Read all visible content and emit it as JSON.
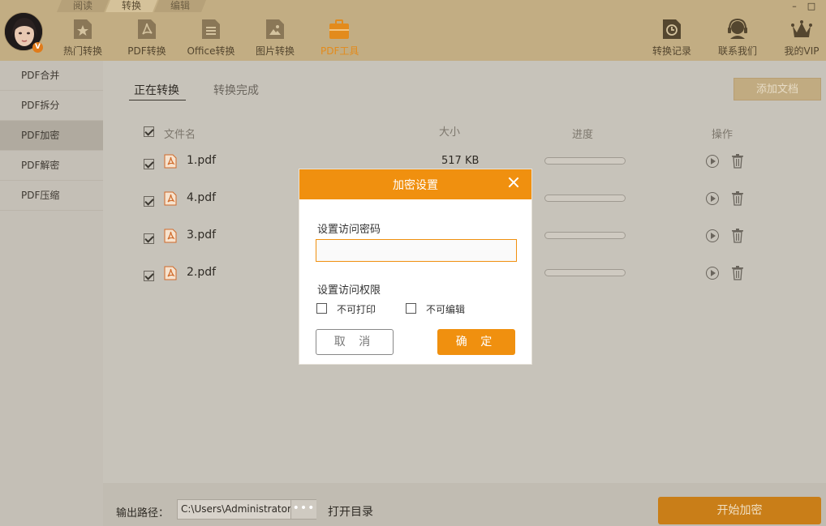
{
  "mode_tabs": [
    "阅读",
    "转换",
    "编辑"
  ],
  "window_controls": {
    "minimize": "–",
    "maximize": "□"
  },
  "toolbar": {
    "left": [
      {
        "label": "热门转换",
        "icon": "star-doc-icon"
      },
      {
        "label": "PDF转换",
        "icon": "pdf-doc-icon"
      },
      {
        "label": "Office转换",
        "icon": "office-doc-icon"
      },
      {
        "label": "图片转换",
        "icon": "image-doc-icon"
      },
      {
        "label": "PDF工具",
        "icon": "briefcase-icon"
      }
    ],
    "right": [
      {
        "label": "转换记录",
        "icon": "history-clock-icon"
      },
      {
        "label": "联系我们",
        "icon": "headset-icon"
      },
      {
        "label": "我的VIP",
        "icon": "crown-icon"
      }
    ]
  },
  "avatar_badge": "V",
  "sidebar": {
    "items": [
      "PDF合并",
      "PDF拆分",
      "PDF加密",
      "PDF解密",
      "PDF压缩"
    ],
    "active": "PDF加密"
  },
  "main": {
    "tabs": [
      "正在转换",
      "转换完成"
    ],
    "add_button": "添加文档",
    "columns": {
      "filename": "文件名",
      "size": "大小",
      "progress": "进度",
      "actions": "操作"
    },
    "files": [
      {
        "name": "1.pdf",
        "size": "517 KB",
        "progress": 0
      },
      {
        "name": "4.pdf",
        "size": "",
        "progress": 0
      },
      {
        "name": "3.pdf",
        "size": "",
        "progress": 0
      },
      {
        "name": "2.pdf",
        "size": "",
        "progress": 0
      }
    ]
  },
  "footer": {
    "output_label": "输出路径：",
    "output_path": "C:\\Users\\Administrator\\",
    "more": "•••",
    "open_dir": "打开目录",
    "start_button": "开始加密"
  },
  "dialog": {
    "title": "加密设置",
    "password_label": "设置访问密码",
    "password_value": "",
    "permission_label": "设置访问权限",
    "no_print": "不可打印",
    "no_edit": "不可编辑",
    "cancel": "取 消",
    "ok": "确 定"
  },
  "colors": {
    "accent": "#f0900f",
    "header_bg": "#c2ad83",
    "overlay": "#c7c3ba"
  }
}
